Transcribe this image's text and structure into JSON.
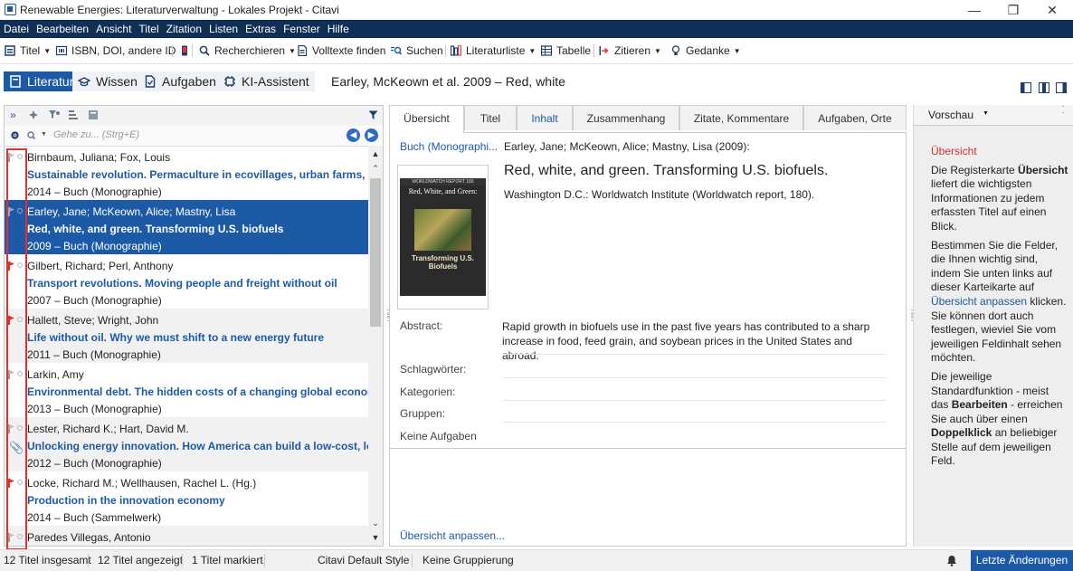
{
  "window": {
    "title": "Renewable Energies: Literaturverwaltung - Lokales Projekt - Citavi"
  },
  "menu": [
    "Datei",
    "Bearbeiten",
    "Ansicht",
    "Titel",
    "Zitation",
    "Listen",
    "Extras",
    "Fenster",
    "Hilfe"
  ],
  "toolbar": {
    "titel": "Titel",
    "isbn": "ISBN, DOI, andere ID",
    "recherchieren": "Recherchieren",
    "volltexte": "Volltexte finden",
    "suchen": "Suchen",
    "literaturliste": "Literaturliste",
    "tabelle": "Tabelle",
    "zitieren": "Zitieren",
    "gedanke": "Gedanke"
  },
  "nav": {
    "literatur": "Literatur",
    "wissen": "Wissen",
    "aufgaben": "Aufgaben",
    "ki": "KI-Assistent",
    "current_reference": "Earley, McKeown et al. 2009 – Red, white"
  },
  "search": {
    "placeholder": "Gehe zu... (Strg+E)"
  },
  "references": [
    {
      "authors": "Birnbaum, Juliana; Fox, Louis",
      "title": "Sustainable revolution. Permaculture in ecovillages, urban farms, and c",
      "meta": "2014 – Buch (Monographie)"
    },
    {
      "authors": "Earley, Jane; McKeown, Alice; Mastny, Lisa",
      "title": "Red, white, and green. Transforming U.S. biofuels",
      "meta": "2009 – Buch (Monographie)"
    },
    {
      "authors": "Gilbert, Richard; Perl, Anthony",
      "title": "Transport revolutions. Moving people and freight without oil",
      "meta": "2007 – Buch (Monographie)"
    },
    {
      "authors": "Hallett, Steve; Wright, John",
      "title": "Life without oil. Why we must shift to a new energy future",
      "meta": "2011 – Buch (Monographie)"
    },
    {
      "authors": "Larkin, Amy",
      "title": "Environmental debt. The hidden costs of a changing global economy",
      "meta": "2013 – Buch (Monographie)"
    },
    {
      "authors": "Lester, Richard K.; Hart, David M.",
      "title": "Unlocking energy innovation. How America can build a low-cost, low-ca",
      "meta": "2012 – Buch (Monographie)"
    },
    {
      "authors": "Locke, Richard M.; Wellhausen, Rachel L. (Hg.)",
      "title": "Production in the innovation economy",
      "meta": "2014 – Buch (Sammelwerk)"
    },
    {
      "authors": "Paredes Villegas, Antonio",
      "title": "",
      "meta": ""
    }
  ],
  "tabs": [
    "Übersicht",
    "Titel",
    "Inhalt",
    "Zusammenhang",
    "Zitate, Kommentare",
    "Aufgaben, Orte"
  ],
  "detail": {
    "type": "Buch (Monographi...",
    "citation_authors": "Earley, Jane; McKeown, Alice; Mastny, Lisa (2009):",
    "title": "Red, white, and green. Transforming U.S. biofuels.",
    "publisher": "Washington D.C.: Worldwatch Institute (Worldwatch report, 180).",
    "cover": {
      "series": "WORLDWATCH REPORT 180",
      "title": "Red, White, and Green:",
      "subtitle": "Transforming U.S. Biofuels"
    },
    "abstract_label": "Abstract:",
    "abstract": "Rapid growth in biofuels use in the past five years has contributed to a sharp increase in food, feed grain, and soybean prices in the United States and abroad.",
    "keywords_label": "Schlagwörter:",
    "categories_label": "Kategorien:",
    "groups_label": "Gruppen:",
    "tasks_label": "Keine Aufgaben",
    "customize_link": "Übersicht anpassen..."
  },
  "preview": {
    "header": "Vorschau",
    "heading": "Übersicht",
    "p1_a": "Die Registerkarte ",
    "p1_b": "Übersicht",
    "p1_c": " liefert die wichtigsten Informationen zu jedem erfassten Titel auf einen Blick.",
    "p2_a": "Bestimmen Sie die Felder, die Ihnen wichtig sind, indem Sie unten links auf dieser Karteikarte auf ",
    "p2_link": "Übersicht anpassen",
    "p2_c": " klicken. Sie können dort auch festlegen, wieviel Sie vom jeweiligen Feldinhalt sehen möchten.",
    "p3_a": "Die jeweilige Standardfunktion - meist das ",
    "p3_b": "Bearbeiten",
    "p3_c": " - erreichen Sie auch über einen ",
    "p3_d": "Doppelklick",
    "p3_e": " an beliebiger Stelle auf dem jeweiligen Feld."
  },
  "status": {
    "total": "12 Titel insgesamt",
    "shown": "12 Titel angezeigt",
    "marked": "1 Titel markiert",
    "style": "Citavi Default Style",
    "grouping": "Keine Gruppierung",
    "recent": "Letzte Änderungen"
  },
  "colors": {
    "accent": "#1d5aa6",
    "menubar": "#0f2f56",
    "flag_red": "#d32222",
    "highlight_box": "#e23030"
  }
}
